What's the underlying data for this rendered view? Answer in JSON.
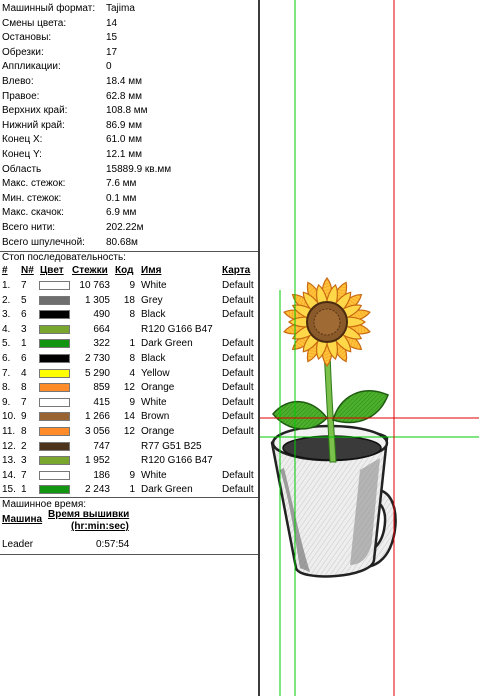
{
  "properties": [
    {
      "label": "Машинный формат:",
      "value": "Tajima"
    },
    {
      "label": "Смены цвета:",
      "value": "14"
    },
    {
      "label": "Остановы:",
      "value": "15"
    },
    {
      "label": "Обрезки:",
      "value": "17"
    },
    {
      "label": "Аппликации:",
      "value": "0"
    },
    {
      "label": "Влево:",
      "value": "18.4 мм"
    },
    {
      "label": "Правое:",
      "value": "62.8 мм"
    },
    {
      "label": "Верхних край:",
      "value": "108.8 мм"
    },
    {
      "label": "Нижний край:",
      "value": "86.9 мм"
    },
    {
      "label": "Конец X:",
      "value": "61.0 мм"
    },
    {
      "label": "Конец Y:",
      "value": "12.1 мм"
    },
    {
      "label": "Область",
      "value": "15889.9 кв.мм"
    },
    {
      "label": "Макс. стежок:",
      "value": "7.6 мм"
    },
    {
      "label": "Мин. стежок:",
      "value": "0.1 мм"
    },
    {
      "label": "Макс. скачок:",
      "value": "6.9 мм"
    },
    {
      "label": "Всего нити:",
      "value": "202.22м"
    },
    {
      "label": "Всего шпулечной:",
      "value": "80.68м"
    }
  ],
  "sequence": {
    "title": "Стоп последовательность:",
    "headers": {
      "idx": "#",
      "n": "N#",
      "color": "Цвет",
      "stitches": "Стежки",
      "code": "Код",
      "name": "Имя",
      "card": "Карта"
    },
    "rows": [
      {
        "idx": "1.",
        "n": "7",
        "color": "#ffffff",
        "stitches": "10 763",
        "code": "9",
        "name": "White",
        "card": "Default"
      },
      {
        "idx": "2.",
        "n": "5",
        "color": "#6e6e6e",
        "stitches": "1 305",
        "code": "18",
        "name": "Grey",
        "card": "Default"
      },
      {
        "idx": "3.",
        "n": "6",
        "color": "#000000",
        "stitches": "490",
        "code": "8",
        "name": "Black",
        "card": "Default"
      },
      {
        "idx": "4.",
        "n": "3",
        "color": "#78a62f",
        "stitches": "664",
        "code": "",
        "name": "R120 G166 B47",
        "card": ""
      },
      {
        "idx": "5.",
        "n": "1",
        "color": "#129612",
        "stitches": "322",
        "code": "1",
        "name": "Dark Green",
        "card": "Default"
      },
      {
        "idx": "6.",
        "n": "6",
        "color": "#000000",
        "stitches": "2 730",
        "code": "8",
        "name": "Black",
        "card": "Default"
      },
      {
        "idx": "7.",
        "n": "4",
        "color": "#ffff00",
        "stitches": "5 290",
        "code": "4",
        "name": "Yellow",
        "card": "Default"
      },
      {
        "idx": "8.",
        "n": "8",
        "color": "#ff8c28",
        "stitches": "859",
        "code": "12",
        "name": "Orange",
        "card": "Default"
      },
      {
        "idx": "9.",
        "n": "7",
        "color": "#ffffff",
        "stitches": "415",
        "code": "9",
        "name": "White",
        "card": "Default"
      },
      {
        "idx": "10.",
        "n": "9",
        "color": "#9a6432",
        "stitches": "1 266",
        "code": "14",
        "name": "Brown",
        "card": "Default"
      },
      {
        "idx": "11.",
        "n": "8",
        "color": "#ff8c28",
        "stitches": "3 056",
        "code": "12",
        "name": "Orange",
        "card": "Default"
      },
      {
        "idx": "12.",
        "n": "2",
        "color": "#4d3319",
        "stitches": "747",
        "code": "",
        "name": "R77 G51 B25",
        "card": ""
      },
      {
        "idx": "13.",
        "n": "3",
        "color": "#78a62f",
        "stitches": "1 952",
        "code": "",
        "name": "R120 G166 B47",
        "card": ""
      },
      {
        "idx": "14.",
        "n": "7",
        "color": "#ffffff",
        "stitches": "186",
        "code": "9",
        "name": "White",
        "card": "Default"
      },
      {
        "idx": "15.",
        "n": "1",
        "color": "#129612",
        "stitches": "2 243",
        "code": "1",
        "name": "Dark Green",
        "card": "Default"
      }
    ]
  },
  "machine_time": {
    "title": "Машинное время:",
    "col_machine": "Машина",
    "col_time": "Время вышивки",
    "col_time_unit": "(hr:min:sec)",
    "rows": [
      {
        "machine": "Leader",
        "time": "0:57:54"
      }
    ]
  },
  "colors": {
    "guide_green": "#00c800",
    "guide_red": "#e00000"
  }
}
